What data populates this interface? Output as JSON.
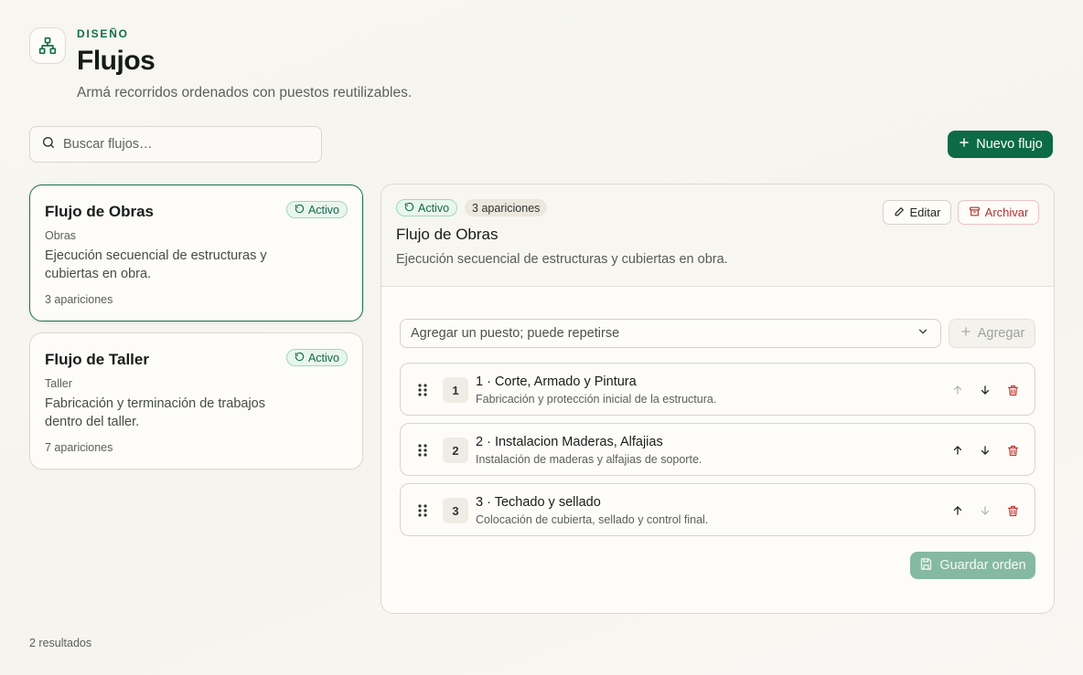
{
  "header": {
    "eyebrow": "DISEÑO",
    "title": "Flujos",
    "subtitle": "Armá recorridos ordenados con puestos reutilizables.",
    "icon": "sitemap-icon"
  },
  "search": {
    "placeholder": "Buscar flujos…",
    "value": ""
  },
  "new_button": {
    "label": "Nuevo flujo"
  },
  "flows": [
    {
      "title": "Flujo de Obras",
      "category": "Obras",
      "description": "Ejecución secuencial de estructuras y cubiertas en obra.",
      "count": "3 apariciones",
      "status": "Activo",
      "selected": true
    },
    {
      "title": "Flujo de Taller",
      "category": "Taller",
      "description": "Fabricación y terminación de trabajos dentro del taller.",
      "count": "7 apariciones",
      "status": "Activo",
      "selected": false
    }
  ],
  "detail": {
    "status": "Activo",
    "count": "3 apariciones",
    "title": "Flujo de Obras",
    "description": "Ejecución secuencial de estructuras y cubiertas en obra.",
    "edit_label": "Editar",
    "archive_label": "Archivar",
    "select_placeholder": "Agregar un puesto; puede repetirse",
    "add_label": "Agregar",
    "steps": [
      {
        "num": "1",
        "title": "1 · Corte, Armado y Pintura",
        "description": "Fabricación y protección inicial de la estructura.",
        "up_enabled": false,
        "down_enabled": true
      },
      {
        "num": "2",
        "title": "2 · Instalacion Maderas, Alfajias",
        "description": "Instalación de maderas y alfajias de soporte.",
        "up_enabled": true,
        "down_enabled": true
      },
      {
        "num": "3",
        "title": "3 · Techado y sellado",
        "description": "Colocación de cubierta, sellado y control final.",
        "up_enabled": true,
        "down_enabled": false
      }
    ],
    "save_label": "Guardar orden"
  },
  "results": "2 resultados",
  "colors": {
    "primary": "#0d6a47",
    "active_badge_bg": "#e8f6ee",
    "danger": "#b3312f",
    "save_disabled": "#86b9a2"
  }
}
